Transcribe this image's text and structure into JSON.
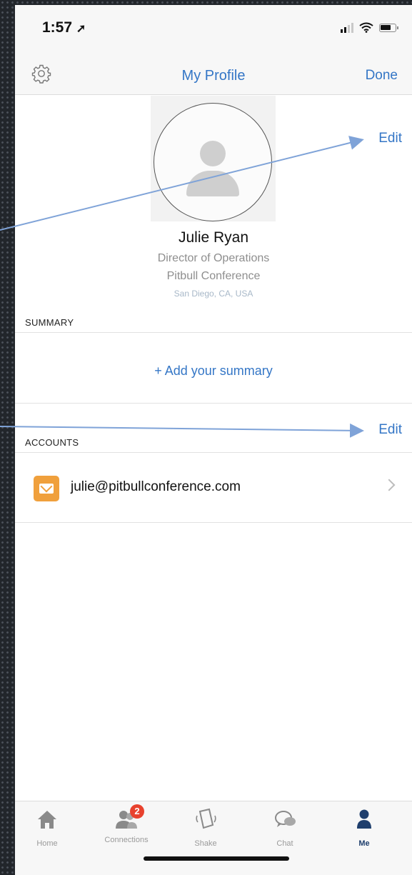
{
  "status_bar": {
    "time": "1:57",
    "location_arrow": "➚"
  },
  "nav": {
    "title": "My Profile",
    "done_label": "Done",
    "settings_icon": "gear-icon"
  },
  "profile": {
    "edit_label": "Edit",
    "name": "Julie Ryan",
    "job_title": "Director of Operations",
    "company": "Pitbull Conference",
    "location": "San Diego, CA, USA"
  },
  "summary": {
    "header": "SUMMARY",
    "add_label": "+ Add your summary"
  },
  "accounts": {
    "header": "ACCOUNTS",
    "edit_label": "Edit",
    "items": [
      {
        "email": "julie@pitbullconference.com",
        "icon": "mail-icon"
      }
    ]
  },
  "tab_bar": {
    "tabs": [
      {
        "label": "Home",
        "icon": "home-icon"
      },
      {
        "label": "Connections",
        "icon": "connections-icon",
        "badge": "2"
      },
      {
        "label": "Shake",
        "icon": "shake-icon"
      },
      {
        "label": "Chat",
        "icon": "chat-icon"
      },
      {
        "label": "Me",
        "icon": "person-icon",
        "active": true
      }
    ]
  },
  "colors": {
    "accent": "#3476c6",
    "badge": "#e8422e",
    "mail": "#f0a03c",
    "annotation_arrow": "#7fa3d8"
  }
}
